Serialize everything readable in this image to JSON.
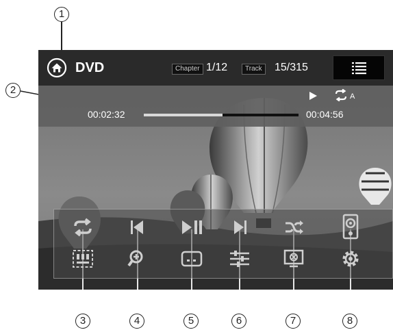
{
  "callouts": [
    "1",
    "2",
    "3",
    "4",
    "5",
    "6",
    "7",
    "8"
  ],
  "header": {
    "title": "DVD",
    "chapter_label": "Chapter",
    "chapter_value": "1/12",
    "track_label": "Track",
    "track_value": "15/315"
  },
  "playback": {
    "elapsed": "00:02:32",
    "total": "00:04:56",
    "progress_fraction": 0.51,
    "state": "playing",
    "repeat_suffix": "A"
  },
  "controls_row1": [
    "repeat-icon",
    "previous-icon",
    "play-pause-icon",
    "next-icon",
    "shuffle-icon",
    "speaker-icon"
  ],
  "controls_row2": [
    "rgb-icon",
    "zoom-icon",
    "subtitle-icon",
    "equalizer-icon",
    "screen-off-icon",
    "settings-icon"
  ],
  "colors": {
    "bar": "#2a2a2a",
    "strip": "#5f5f5f",
    "panel": "#4b4b4b",
    "icon": "#cfcfcf"
  }
}
